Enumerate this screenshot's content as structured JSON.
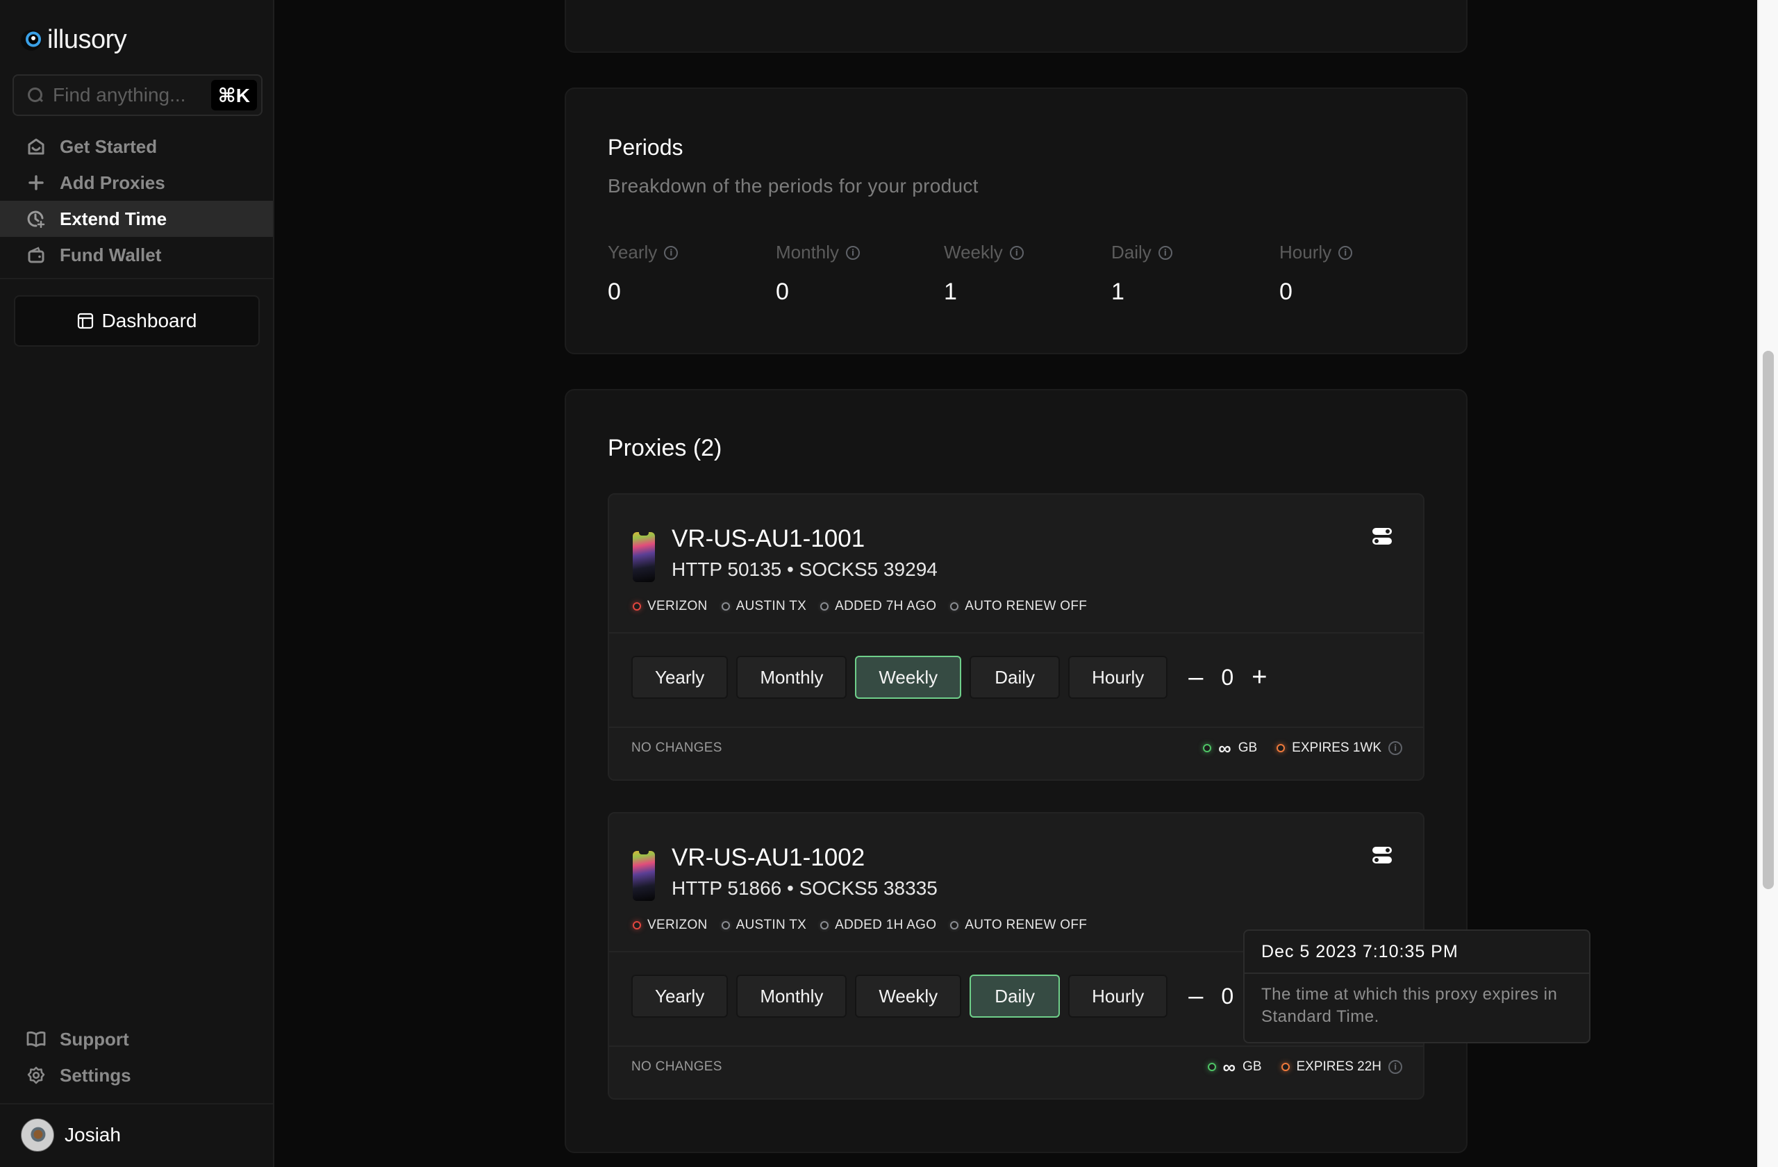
{
  "app": {
    "name": "illusory"
  },
  "search": {
    "placeholder": "Find anything...",
    "shortcut": "⌘K"
  },
  "sidebar": {
    "items": [
      {
        "label": "Get Started",
        "icon": "home-smile-icon",
        "active": false
      },
      {
        "label": "Add Proxies",
        "icon": "plus-icon",
        "active": false
      },
      {
        "label": "Extend Time",
        "icon": "clock-plus-icon",
        "active": true
      },
      {
        "label": "Fund Wallet",
        "icon": "wallet-icon",
        "active": false
      }
    ],
    "dashboard_label": "Dashboard",
    "bottom_items": [
      {
        "label": "Support",
        "icon": "book-icon"
      },
      {
        "label": "Settings",
        "icon": "gear-icon"
      }
    ],
    "user": {
      "name": "Josiah"
    }
  },
  "periods": {
    "title": "Periods",
    "subtitle": "Breakdown of the periods for your product",
    "stats": [
      {
        "label": "Yearly",
        "value": "0"
      },
      {
        "label": "Monthly",
        "value": "0"
      },
      {
        "label": "Weekly",
        "value": "1"
      },
      {
        "label": "Daily",
        "value": "1"
      },
      {
        "label": "Hourly",
        "value": "0"
      }
    ]
  },
  "proxies": {
    "title": "Proxies (2)",
    "period_options": [
      "Yearly",
      "Monthly",
      "Weekly",
      "Daily",
      "Hourly"
    ],
    "items": [
      {
        "name": "VR-US-AU1-1001",
        "ports": "HTTP 50135 • SOCKS5 39294",
        "tags": [
          {
            "label": "VERIZON",
            "status": "red"
          },
          {
            "label": "AUSTIN TX",
            "status": "gray"
          },
          {
            "label": "ADDED 7H AGO",
            "status": "gray"
          },
          {
            "label": "AUTO RENEW OFF",
            "status": "gray"
          }
        ],
        "selected_period": "Weekly",
        "quantity": "0",
        "changes": "NO CHANGES",
        "data_symbol": "∞",
        "data_unit": "GB",
        "expires": "EXPIRES 1WK"
      },
      {
        "name": "VR-US-AU1-1002",
        "ports": "HTTP 51866 • SOCKS5 38335",
        "tags": [
          {
            "label": "VERIZON",
            "status": "red"
          },
          {
            "label": "AUSTIN TX",
            "status": "gray"
          },
          {
            "label": "ADDED 1H AGO",
            "status": "gray"
          },
          {
            "label": "AUTO RENEW OFF",
            "status": "gray"
          }
        ],
        "selected_period": "Daily",
        "quantity": "0",
        "changes": "NO CHANGES",
        "data_symbol": "∞",
        "data_unit": "GB",
        "expires": "EXPIRES 22H"
      }
    ]
  },
  "tooltip": {
    "title": "Dec 5 2023 7:10:35 PM",
    "body": "The time at which this proxy expires in Standard Time."
  },
  "colors": {
    "accent_selected": "#364b43",
    "accent_selected_border": "#6fcf8a",
    "status_red": "#e2463f",
    "status_green": "#4fc566",
    "status_orange": "#f07a3c"
  }
}
